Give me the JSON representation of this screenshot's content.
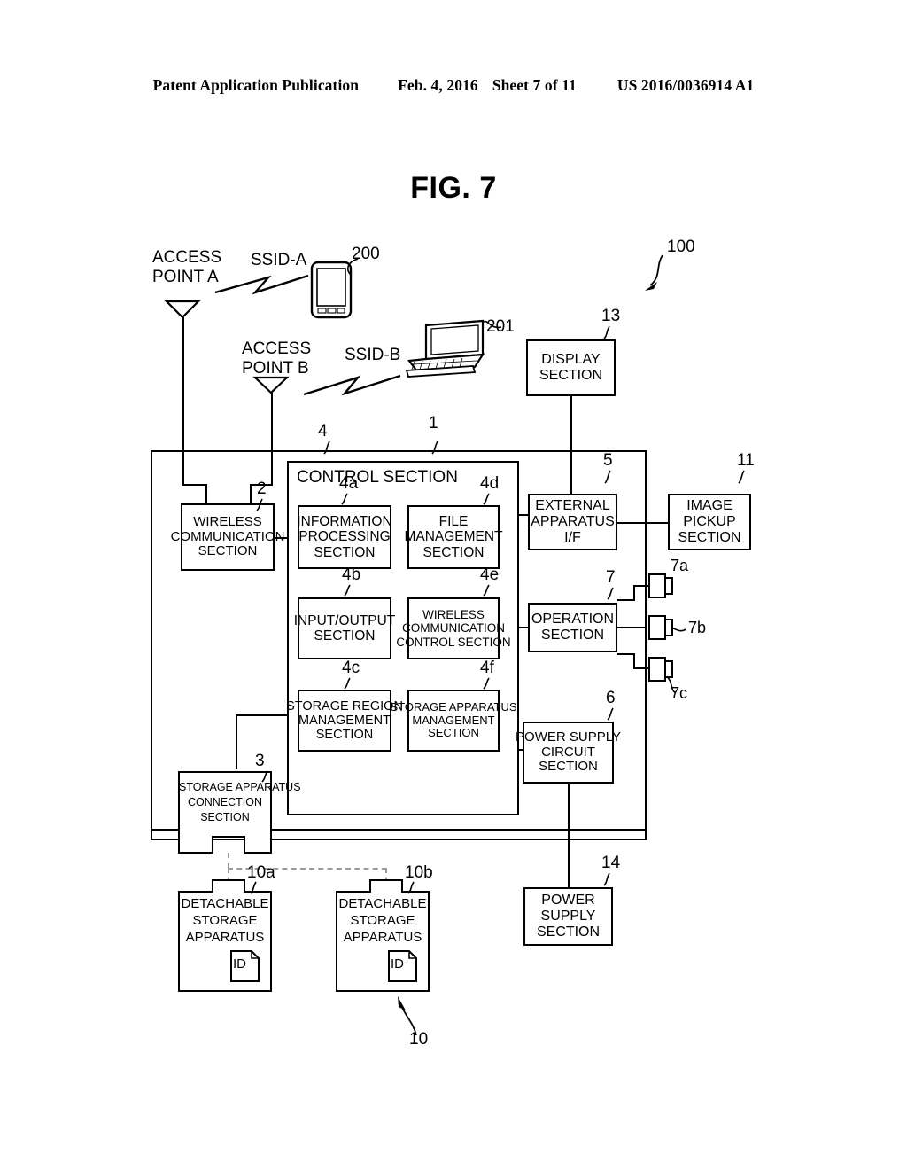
{
  "header": {
    "publication": "Patent Application Publication",
    "date": "Feb. 4, 2016",
    "sheet": "Sheet 7 of 11",
    "patent_number": "US 2016/0036914 A1"
  },
  "figure": {
    "title": "FIG. 7",
    "system_ref": "100",
    "storage_group_ref": "10"
  },
  "network": {
    "access_point_a": "ACCESS\nPOINT A",
    "access_point_a_line1": "ACCESS",
    "access_point_a_line2": "POINT A",
    "access_point_b_line1": "ACCESS",
    "access_point_b_line2": "POINT B",
    "ssid_a": "SSID-A",
    "ssid_b": "SSID-B",
    "tablet_ref": "200",
    "laptop_ref": "201"
  },
  "blocks": {
    "device": {
      "ref": "1"
    },
    "wireless_communication": {
      "ref": "2",
      "lines": [
        "WIRELESS",
        "COMMUNICATION",
        "SECTION"
      ]
    },
    "storage_connection": {
      "ref": "3",
      "lines": [
        "STORAGE APPARATUS",
        "CONNECTION",
        "SECTION"
      ]
    },
    "control_section": {
      "ref": "4",
      "title": "CONTROL SECTION"
    },
    "information_processing": {
      "ref": "4a",
      "lines": [
        "INFORMATION",
        "PROCESSING",
        "SECTION"
      ]
    },
    "input_output": {
      "ref": "4b",
      "lines": [
        "INPUT/OUTPUT",
        "SECTION"
      ]
    },
    "storage_region_management": {
      "ref": "4c",
      "lines": [
        "STORAGE REGION",
        "MANAGEMENT",
        "SECTION"
      ]
    },
    "file_management": {
      "ref": "4d",
      "lines": [
        "FILE",
        "MANAGEMENT",
        "SECTION"
      ]
    },
    "wireless_communication_control": {
      "ref": "4e",
      "lines": [
        "WIRELESS",
        "COMMUNICATION",
        "CONTROL SECTION"
      ]
    },
    "storage_apparatus_management": {
      "ref": "4f",
      "lines": [
        "STORAGE APPARATUS",
        "MANAGEMENT",
        "SECTION"
      ]
    },
    "external_apparatus_if": {
      "ref": "5",
      "lines": [
        "EXTERNAL",
        "APPARATUS",
        "I/F"
      ]
    },
    "power_supply_circuit": {
      "ref": "6",
      "lines": [
        "POWER SUPPLY",
        "CIRCUIT",
        "SECTION"
      ]
    },
    "operation_section": {
      "ref": "7",
      "lines": [
        "OPERATION",
        "SECTION"
      ]
    },
    "operation_button_a": {
      "ref": "7a"
    },
    "operation_button_b": {
      "ref": "7b"
    },
    "operation_button_c": {
      "ref": "7c"
    },
    "detachable_storage_a": {
      "ref": "10a",
      "lines": [
        "DETACHABLE",
        "STORAGE",
        "APPARATUS"
      ],
      "id_label": "ID"
    },
    "detachable_storage_b": {
      "ref": "10b",
      "lines": [
        "DETACHABLE",
        "STORAGE",
        "APPARATUS"
      ],
      "id_label": "ID"
    },
    "image_pickup": {
      "ref": "11",
      "lines": [
        "IMAGE",
        "PICKUP",
        "SECTION"
      ]
    },
    "display_section": {
      "ref": "13",
      "lines": [
        "DISPLAY",
        "SECTION"
      ]
    },
    "power_supply_section": {
      "ref": "14",
      "lines": [
        "POWER",
        "SUPPLY",
        "SECTION"
      ]
    }
  }
}
